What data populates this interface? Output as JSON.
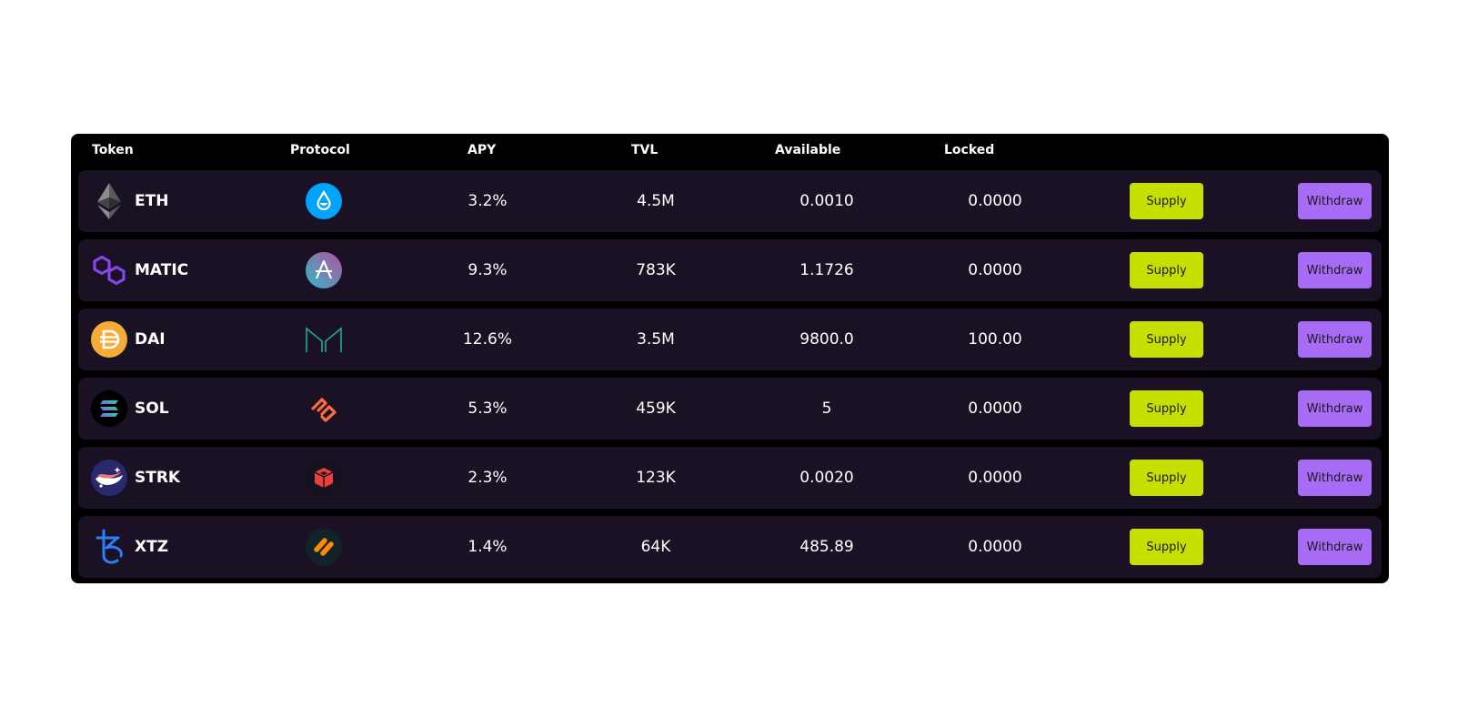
{
  "headers": {
    "token": "Token",
    "protocol": "Protocol",
    "apy": "APY",
    "tvl": "TVL",
    "available": "Available",
    "locked": "Locked"
  },
  "rows": [
    {
      "token": "ETH",
      "token_icon": "ethereum-icon",
      "protocol_icon": "lido-icon",
      "apy": "3.2%",
      "tvl": "4.5M",
      "available": "0.0010",
      "locked": "0.0000",
      "supply_label": "Supply",
      "withdraw_label": "Withdraw"
    },
    {
      "token": "MATIC",
      "token_icon": "polygon-icon",
      "protocol_icon": "aave-icon",
      "apy": "9.3%",
      "tvl": "783K",
      "available": "1.1726",
      "locked": "0.0000",
      "supply_label": "Supply",
      "withdraw_label": "Withdraw"
    },
    {
      "token": "DAI",
      "token_icon": "dai-icon",
      "protocol_icon": "maker-icon",
      "apy": "12.6%",
      "tvl": "3.5M",
      "available": "9800.0",
      "locked": "100.00",
      "supply_label": "Supply",
      "withdraw_label": "Withdraw"
    },
    {
      "token": "SOL",
      "token_icon": "solana-icon",
      "protocol_icon": "synthetix-icon",
      "apy": "5.3%",
      "tvl": "459K",
      "available": "5",
      "locked": "0.0000",
      "supply_label": "Supply",
      "withdraw_label": "Withdraw"
    },
    {
      "token": "STRK",
      "token_icon": "starknet-icon",
      "protocol_icon": "cube-protocol-icon",
      "apy": "2.3%",
      "tvl": "123K",
      "available": "0.0020",
      "locked": "0.0000",
      "supply_label": "Supply",
      "withdraw_label": "Withdraw"
    },
    {
      "token": "XTZ",
      "token_icon": "tezos-icon",
      "protocol_icon": "stripes-protocol-icon",
      "apy": "1.4%",
      "tvl": "64K",
      "available": "485.89",
      "locked": "0.0000",
      "supply_label": "Supply",
      "withdraw_label": "Withdraw"
    }
  ],
  "colors": {
    "panel_bg": "#000000",
    "row_bg": "#1a1224",
    "supply_button": "#c5e000",
    "withdraw_button": "#a86bf5",
    "text": "#ffffff"
  }
}
